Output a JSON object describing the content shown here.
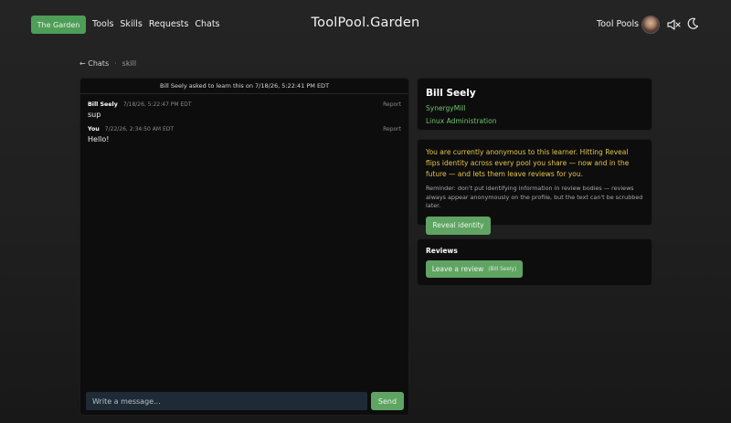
{
  "header": {
    "brand": "The Garden",
    "nav": [
      "Tools",
      "Skills",
      "Requests",
      "Chats"
    ],
    "site_title": "ToolPool.Garden",
    "tool_pools": "Tool Pools"
  },
  "breadcrumb": {
    "back": "← Chats",
    "separator": "·",
    "current": "skill"
  },
  "chat": {
    "banner": "Bill Seely asked to learn this on 7/18/26, 5:22:41 PM EDT",
    "messages": [
      {
        "author": "Bill Seely",
        "time": "7/18/26, 5:22:47 PM EDT",
        "body": "sup",
        "report": "Report"
      },
      {
        "author": "You",
        "time": "7/22/26, 2:34:50 AM EDT",
        "body": "Hello!",
        "report": "Report"
      }
    ],
    "input_placeholder": "Write a message...",
    "send_label": "Send"
  },
  "profile": {
    "name": "Bill Seely",
    "org": "SynergyMill",
    "skill": "Linux Administration"
  },
  "anonymity": {
    "warning": "You are currently anonymous to this learner. Hitting Reveal flips identity across every pool you share — now and in the future — and lets them leave reviews for you.",
    "reminder": "Reminder: don't put identifying information in review bodies — reviews always appear anonymously on the profile, but the text can't be scrubbed later.",
    "reveal_label": "Reveal identity"
  },
  "reviews": {
    "title": "Reviews",
    "button_label": "Leave a review",
    "button_target": "(Bill Seely)"
  },
  "colors": {
    "accent_green": "#5fa463",
    "link_green": "#6fc46d",
    "warning_yellow": "#e4c34b",
    "panel_bg": "#0d0d0d",
    "input_bg": "#1e2a36"
  }
}
